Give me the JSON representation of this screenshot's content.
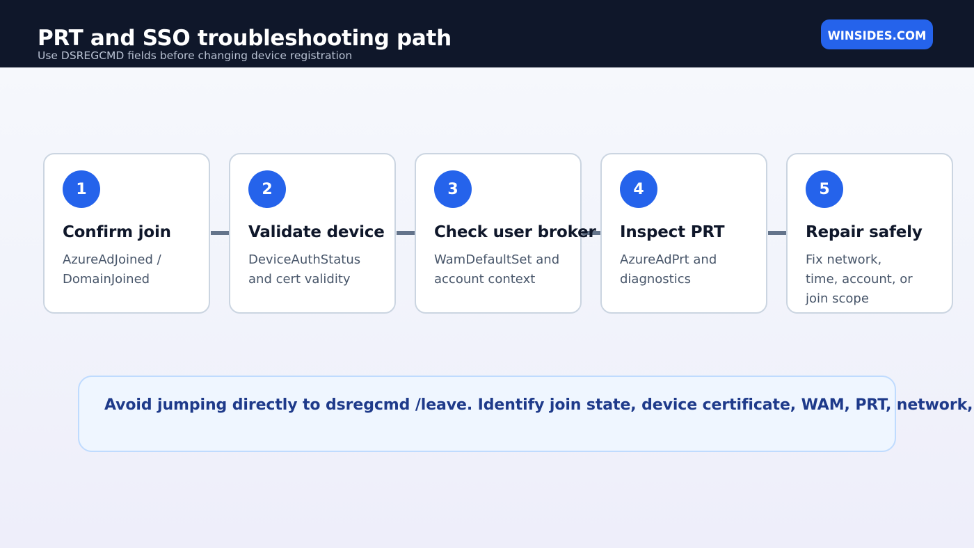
{
  "header": {
    "title": "PRT and SSO troubleshooting path",
    "subtitle": "Use DSREGCMD fields before changing device registration",
    "brand": "WINSIDES.COM"
  },
  "steps": [
    {
      "number": "1",
      "title": "Confirm join",
      "lines": [
        "AzureAdJoined /",
        "DomainJoined"
      ]
    },
    {
      "number": "2",
      "title": "Validate device",
      "lines": [
        "DeviceAuthStatus",
        "and cert validity"
      ]
    },
    {
      "number": "3",
      "title": "Check user broker",
      "lines": [
        "WamDefaultSet and",
        "account context"
      ]
    },
    {
      "number": "4",
      "title": "Inspect PRT",
      "lines": [
        "AzureAdPrt and",
        "diagnostics"
      ]
    },
    {
      "number": "5",
      "title": "Repair safely",
      "lines": [
        "Fix network,",
        "time, account, or",
        "join scope"
      ]
    }
  ],
  "callout": {
    "text": "Avoid jumping directly to dsregcmd /leave. Identify join state, device certificate, WAM, PRT, network, or t"
  },
  "colors": {
    "header_bg": "#0f172a",
    "accent": "#2563eb",
    "connector": "#64748b",
    "callout_bg": "#eff6ff",
    "callout_text": "#1e3a8a"
  }
}
